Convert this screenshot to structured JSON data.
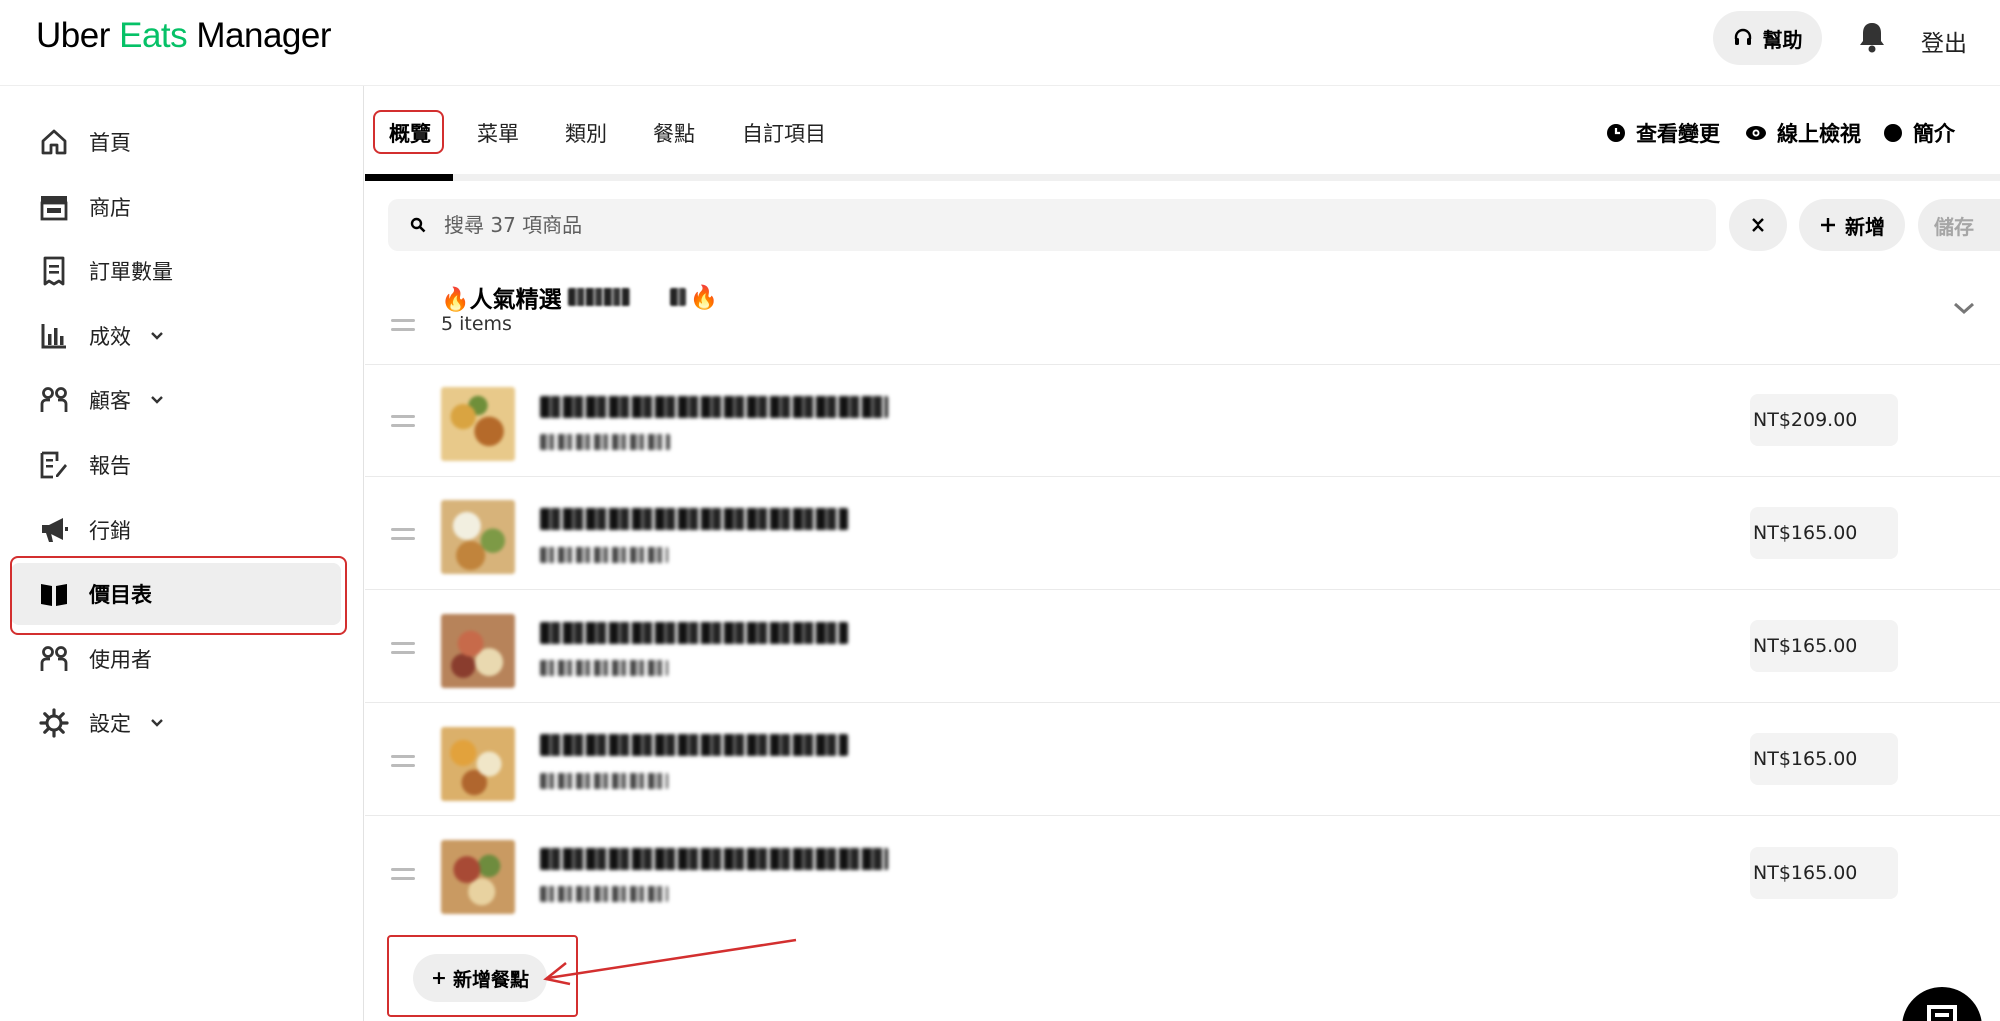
{
  "header": {
    "logo_prefix": "Uber ",
    "logo_eats": "Eats",
    "logo_suffix": " Manager",
    "help_label": "幫助",
    "logout_label": "登出"
  },
  "sidebar": {
    "items": [
      {
        "label": "首頁",
        "icon": "home-icon"
      },
      {
        "label": "商店",
        "icon": "store-icon"
      },
      {
        "label": "訂單數量",
        "icon": "receipt-icon"
      },
      {
        "label": "成效",
        "icon": "chart-icon",
        "expandable": true
      },
      {
        "label": "顧客",
        "icon": "customers-icon",
        "expandable": true
      },
      {
        "label": "報告",
        "icon": "report-icon"
      },
      {
        "label": "行銷",
        "icon": "megaphone-icon"
      },
      {
        "label": "價目表",
        "icon": "menu-book-icon",
        "active": true
      },
      {
        "label": "使用者",
        "icon": "users-icon"
      },
      {
        "label": "設定",
        "icon": "gear-icon",
        "expandable": true
      }
    ]
  },
  "tabs": {
    "items": [
      "概覽",
      "菜單",
      "類別",
      "餐點",
      "自訂項目"
    ],
    "active": "概覽",
    "actions": {
      "view_changes": "查看變更",
      "preview": "線上檢視",
      "intro": "簡介"
    }
  },
  "toolbar": {
    "search_placeholder": "搜尋 37 項商品",
    "add_label": "新增",
    "save_label": "儲存"
  },
  "category": {
    "title_prefix": "🔥人氣精選 ",
    "title_suffix": "🔥",
    "count": "5 items"
  },
  "items": [
    {
      "price": "NT$209.00"
    },
    {
      "price": "NT$165.00"
    },
    {
      "price": "NT$165.00"
    },
    {
      "price": "NT$165.00"
    },
    {
      "price": "NT$165.00"
    }
  ],
  "add_item_label": "新增餐點",
  "colors": {
    "brand_green": "#06c167",
    "highlight_red": "#d32f2f",
    "active_bg": "#eeeeee"
  }
}
